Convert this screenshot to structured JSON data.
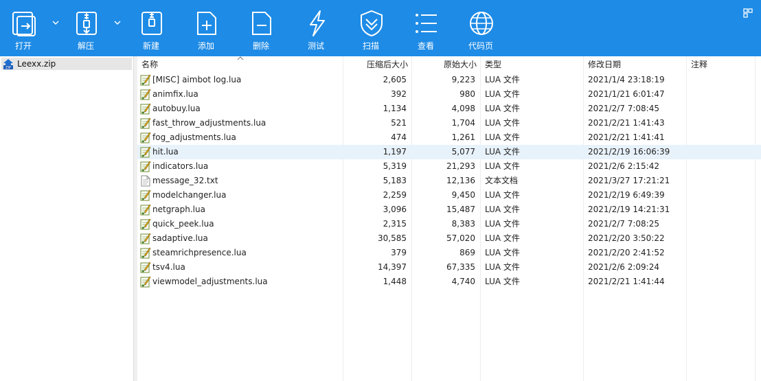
{
  "toolbar": {
    "buttons": [
      {
        "label": "打开",
        "icon": "open-icon",
        "has_dropdown": true
      },
      {
        "label": "解压",
        "icon": "extract-icon",
        "has_dropdown": true
      },
      {
        "label": "新建",
        "icon": "new-archive-icon"
      },
      {
        "label": "添加",
        "icon": "add-file-icon"
      },
      {
        "label": "删除",
        "icon": "delete-file-icon"
      },
      {
        "label": "测试",
        "icon": "test-lightning-icon"
      },
      {
        "label": "扫描",
        "icon": "scan-shield-icon"
      },
      {
        "label": "查看",
        "icon": "view-list-icon"
      },
      {
        "label": "代码页",
        "icon": "codepage-globe-icon"
      }
    ],
    "colors": {
      "background": "#1e8be6",
      "text": "#ffffff"
    }
  },
  "tree": {
    "items": [
      {
        "label": "Leexx.zip",
        "icon": "zip-archive-icon",
        "selected": true
      }
    ]
  },
  "list": {
    "columns": [
      "名称",
      "压缩后大小",
      "原始大小",
      "类型",
      "修改日期",
      "注释"
    ],
    "sorted_column": "名称",
    "selected_row": 5,
    "selection_color": "#e8f2fb",
    "rows": [
      {
        "name": "[MISC] aimbot log.lua",
        "packed": "2,605",
        "size": "9,223",
        "type": "LUA 文件",
        "modified": "2021/1/4 23:18:19",
        "comment": "",
        "icon": "lua-file-icon"
      },
      {
        "name": "animfix.lua",
        "packed": "392",
        "size": "980",
        "type": "LUA 文件",
        "modified": "2021/1/21 6:01:47",
        "comment": "",
        "icon": "lua-file-icon"
      },
      {
        "name": "autobuy.lua",
        "packed": "1,134",
        "size": "4,098",
        "type": "LUA 文件",
        "modified": "2021/2/7 7:08:45",
        "comment": "",
        "icon": "lua-file-icon"
      },
      {
        "name": "fast_throw_adjustments.lua",
        "packed": "521",
        "size": "1,704",
        "type": "LUA 文件",
        "modified": "2021/2/21 1:41:43",
        "comment": "",
        "icon": "lua-file-icon"
      },
      {
        "name": "fog_adjustments.lua",
        "packed": "474",
        "size": "1,261",
        "type": "LUA 文件",
        "modified": "2021/2/21 1:41:41",
        "comment": "",
        "icon": "lua-file-icon"
      },
      {
        "name": "hit.lua",
        "packed": "1,197",
        "size": "5,077",
        "type": "LUA 文件",
        "modified": "2021/2/19 16:06:39",
        "comment": "",
        "icon": "lua-file-icon"
      },
      {
        "name": "indicators.lua",
        "packed": "5,319",
        "size": "21,293",
        "type": "LUA 文件",
        "modified": "2021/2/6 2:15:42",
        "comment": "",
        "icon": "lua-file-icon"
      },
      {
        "name": "message_32.txt",
        "packed": "5,183",
        "size": "12,136",
        "type": "文本文档",
        "modified": "2021/3/27 17:21:21",
        "comment": "",
        "icon": "text-file-icon"
      },
      {
        "name": "modelchanger.lua",
        "packed": "2,259",
        "size": "9,450",
        "type": "LUA 文件",
        "modified": "2021/2/19 6:49:39",
        "comment": "",
        "icon": "lua-file-icon"
      },
      {
        "name": "netgraph.lua",
        "packed": "3,096",
        "size": "15,487",
        "type": "LUA 文件",
        "modified": "2021/2/19 14:21:31",
        "comment": "",
        "icon": "lua-file-icon"
      },
      {
        "name": "quick_peek.lua",
        "packed": "2,315",
        "size": "8,383",
        "type": "LUA 文件",
        "modified": "2021/2/7 7:08:25",
        "comment": "",
        "icon": "lua-file-icon"
      },
      {
        "name": "sadaptive.lua",
        "packed": "30,585",
        "size": "57,020",
        "type": "LUA 文件",
        "modified": "2021/2/20 3:50:22",
        "comment": "",
        "icon": "lua-file-icon"
      },
      {
        "name": "steamrichpresence.lua",
        "packed": "379",
        "size": "869",
        "type": "LUA 文件",
        "modified": "2021/2/20 2:41:52",
        "comment": "",
        "icon": "lua-file-icon"
      },
      {
        "name": "tsv4.lua",
        "packed": "14,397",
        "size": "67,335",
        "type": "LUA 文件",
        "modified": "2021/2/6 2:09:24",
        "comment": "",
        "icon": "lua-file-icon"
      },
      {
        "name": "viewmodel_adjustments.lua",
        "packed": "1,448",
        "size": "4,740",
        "type": "LUA 文件",
        "modified": "2021/2/21 1:41:44",
        "comment": "",
        "icon": "lua-file-icon"
      }
    ]
  }
}
